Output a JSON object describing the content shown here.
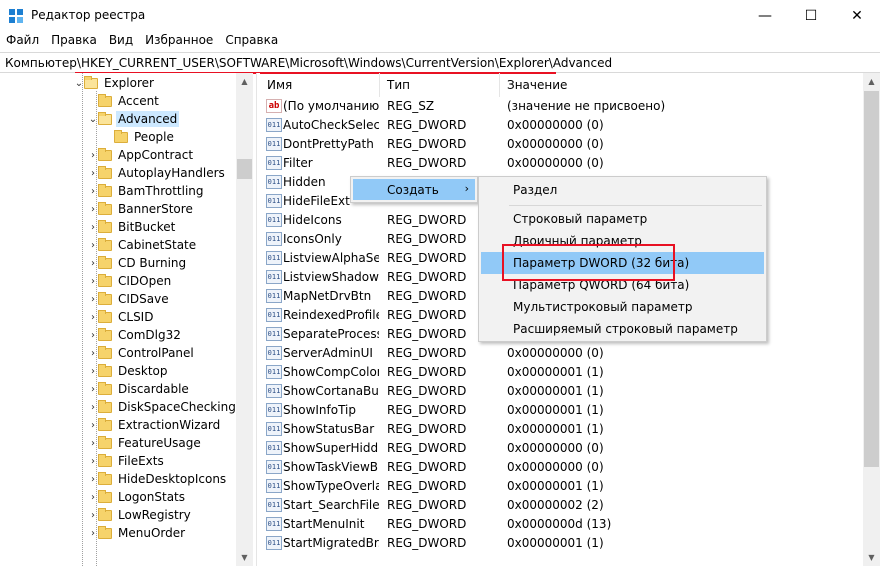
{
  "window": {
    "title": "Редактор реестра",
    "buttons": {
      "minimize": "—",
      "maximize": "☐",
      "close": "✕"
    }
  },
  "menu": [
    "Файл",
    "Правка",
    "Вид",
    "Избранное",
    "Справка"
  ],
  "address": "Компьютер\\HKEY_CURRENT_USER\\SOFTWARE\\Microsoft\\Windows\\CurrentVersion\\Explorer\\Advanced",
  "tree": {
    "explorer": "Explorer",
    "accent": "Accent",
    "advanced": "Advanced",
    "people": "People",
    "children": [
      "AppContract",
      "AutoplayHandlers",
      "BamThrottling",
      "BannerStore",
      "BitBucket",
      "CabinetState",
      "CD Burning",
      "CIDOpen",
      "CIDSave",
      "CLSID",
      "ComDlg32",
      "ControlPanel",
      "Desktop",
      "Discardable",
      "DiskSpaceChecking",
      "ExtractionWizard",
      "FeatureUsage",
      "FileExts",
      "HideDesktopIcons",
      "LogonStats",
      "LowRegistry",
      "MenuOrder"
    ]
  },
  "columns": {
    "name": "Имя",
    "type": "Тип",
    "data": "Значение"
  },
  "values": [
    {
      "name": "(По умолчанию)",
      "type": "REG_SZ",
      "data": "(значение не присвоено)",
      "icon": "string-value-icon"
    },
    {
      "name": "AutoCheckSelect",
      "type": "REG_DWORD",
      "data": "0x00000000 (0)",
      "icon": "dword-value-icon"
    },
    {
      "name": "DontPrettyPath",
      "type": "REG_DWORD",
      "data": "0x00000000 (0)",
      "icon": "dword-value-icon"
    },
    {
      "name": "Filter",
      "type": "REG_DWORD",
      "data": "0x00000000 (0)",
      "icon": "dword-value-icon"
    },
    {
      "name": "Hidden",
      "type": "",
      "data": "",
      "icon": "dword-value-icon"
    },
    {
      "name": "HideFileExt",
      "type": "",
      "data": "",
      "icon": "dword-value-icon"
    },
    {
      "name": "HideIcons",
      "type": "REG_DWORD",
      "data": "",
      "icon": "dword-value-icon"
    },
    {
      "name": "IconsOnly",
      "type": "REG_DWORD",
      "data": "",
      "icon": "dword-value-icon"
    },
    {
      "name": "ListviewAlphaSe...",
      "type": "REG_DWORD",
      "data": "",
      "icon": "dword-value-icon"
    },
    {
      "name": "ListviewShadow",
      "type": "REG_DWORD",
      "data": "",
      "icon": "dword-value-icon"
    },
    {
      "name": "MapNetDrvBtn",
      "type": "REG_DWORD",
      "data": "",
      "icon": "dword-value-icon"
    },
    {
      "name": "ReindexedProfile",
      "type": "REG_DWORD",
      "data": "",
      "icon": "dword-value-icon"
    },
    {
      "name": "SeparateProcess",
      "type": "REG_DWORD",
      "data": "",
      "icon": "dword-value-icon"
    },
    {
      "name": "ServerAdminUI",
      "type": "REG_DWORD",
      "data": "0x00000000 (0)",
      "icon": "dword-value-icon"
    },
    {
      "name": "ShowCompColor",
      "type": "REG_DWORD",
      "data": "0x00000001 (1)",
      "icon": "dword-value-icon"
    },
    {
      "name": "ShowCortanaBu...",
      "type": "REG_DWORD",
      "data": "0x00000001 (1)",
      "icon": "dword-value-icon"
    },
    {
      "name": "ShowInfoTip",
      "type": "REG_DWORD",
      "data": "0x00000001 (1)",
      "icon": "dword-value-icon"
    },
    {
      "name": "ShowStatusBar",
      "type": "REG_DWORD",
      "data": "0x00000001 (1)",
      "icon": "dword-value-icon"
    },
    {
      "name": "ShowSuperHidd...",
      "type": "REG_DWORD",
      "data": "0x00000000 (0)",
      "icon": "dword-value-icon"
    },
    {
      "name": "ShowTaskViewB...",
      "type": "REG_DWORD",
      "data": "0x00000000 (0)",
      "icon": "dword-value-icon"
    },
    {
      "name": "ShowTypeOverlay",
      "type": "REG_DWORD",
      "data": "0x00000001 (1)",
      "icon": "dword-value-icon"
    },
    {
      "name": "Start_SearchFiles",
      "type": "REG_DWORD",
      "data": "0x00000002 (2)",
      "icon": "dword-value-icon"
    },
    {
      "name": "StartMenuInit",
      "type": "REG_DWORD",
      "data": "0x0000000d (13)",
      "icon": "dword-value-icon"
    },
    {
      "name": "StartMigratedBr...",
      "type": "REG_DWORD",
      "data": "0x00000001 (1)",
      "icon": "dword-value-icon"
    }
  ],
  "context_menu": {
    "create": "Создать",
    "submenu": {
      "key": "Раздел",
      "string": "Строковый параметр",
      "binary": "Двоичный параметр",
      "dword": "Параметр DWORD (32 бита)",
      "qword": "Параметр QWORD (64 бита)",
      "multi": "Мультистроковый параметр",
      "expand": "Расширяемый строковый параметр"
    }
  },
  "colors": {
    "highlight": "#91c9f7",
    "annotation": "#e81123",
    "selection": "#cce8ff"
  }
}
